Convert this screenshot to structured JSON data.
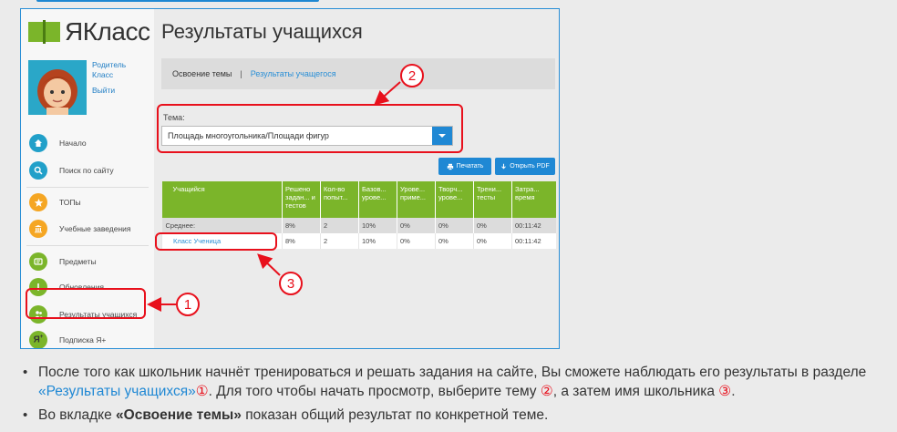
{
  "app": {
    "logo_text": "ЯКласс",
    "page_title": "Результаты учащихся"
  },
  "profile": {
    "role": "Родитель",
    "name": "Класс",
    "logout": "Выйти"
  },
  "sidebar": {
    "items": [
      {
        "label": "Начало",
        "icon": "home-icon"
      },
      {
        "label": "Поиск по сайту",
        "icon": "search-icon"
      },
      {
        "label": "ТОПы",
        "icon": "star-icon"
      },
      {
        "label": "Учебные заведения",
        "icon": "building-icon"
      },
      {
        "label": "Предметы",
        "icon": "subjects-icon"
      },
      {
        "label": "Обновления",
        "icon": "exclamation-icon"
      },
      {
        "label": "Результаты учащихся",
        "icon": "users-icon"
      },
      {
        "label": "Подписка Я+",
        "icon": "ya-plus-icon"
      }
    ]
  },
  "tabs": {
    "tab1": "Освоение темы",
    "separator": "|",
    "tab2": "Результаты учащегося"
  },
  "topic": {
    "label": "Тема:",
    "value": "Площадь многоугольника/Площади фигур"
  },
  "buttons": {
    "print": "Печатать",
    "pdf": "Открыть PDF"
  },
  "table": {
    "headers": [
      "Учащийся",
      "Решено задан... и тестов",
      "Кол-во попыт...",
      "Базов... уровe...",
      "Урове... приме...",
      "Творч... уровe...",
      "Трени... тесты",
      "Затра... время"
    ],
    "avg_row": [
      "Среднее:",
      "8%",
      "2",
      "10%",
      "0%",
      "0%",
      "0%",
      "00:11:42"
    ],
    "student_row": [
      "Класс Ученица",
      "8%",
      "2",
      "10%",
      "0%",
      "0%",
      "0%",
      "00:11:42"
    ]
  },
  "markers": {
    "one": "1",
    "two": "2",
    "three": "3"
  },
  "bullets": {
    "b1_part1": "После того как школьник начнёт тренироваться и решать задания на сайте, Вы сможете наблюдать его результаты в разделе ",
    "b1_link": "«Результаты учащихся»",
    "b1_m1": "①",
    "b1_part2": ". Для того чтобы начать просмотр, выберите тему ",
    "b1_m2": "②",
    "b1_part3": ", а затем имя школьника ",
    "b1_m3": "③",
    "b1_part4": ".",
    "b2_part1": "Во вкладке ",
    "b2_bold": "«Освоение темы»",
    "b2_part2": " показан общий результат по конкретной теме."
  },
  "colors": {
    "accent_blue": "#1f88d4",
    "table_green": "#7bb52a",
    "annotation_red": "#e8101c"
  }
}
